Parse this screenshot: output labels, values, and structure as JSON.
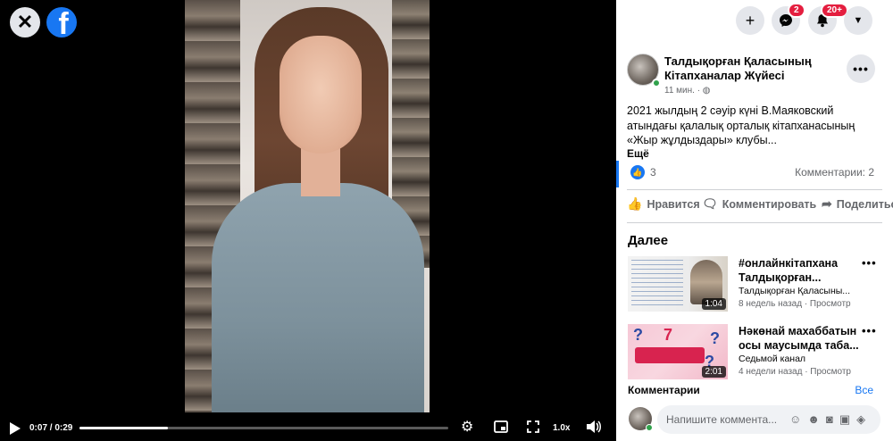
{
  "player": {
    "time_label": "0:07 / 0:29",
    "progress": 0.24,
    "speed_label": "1.0x"
  },
  "topbar": {
    "messenger_badge": "2",
    "notifications_badge": "20+"
  },
  "post": {
    "author": "Талдықорған Қаласының Кітапханалар Жүйесі",
    "time": "11 мин. · ◍",
    "text": "2021 жылдың 2 сәуір күні В.Маяковский атындағы қалалық орталық кітапханасының «Жыр жұлдыздары» клубы...",
    "see_more": "Ещё",
    "likes": "3",
    "comments_count": "Комментарии: 2",
    "actions": {
      "like": "Нравится",
      "comment": "Комментировать",
      "share": "Поделиться"
    }
  },
  "next": {
    "title": "Далее",
    "items": [
      {
        "title": "#онлайнкітапхана Талдықорған...",
        "channel": "Талдықорған Қаласыны...",
        "meta": "8 недель назад · Просмотр",
        "duration": "1:04"
      },
      {
        "title": "Нәкөнай махаббатын осы маусымда таба...",
        "channel": "Седьмой канал",
        "meta": "4 недели назад · Просмотр",
        "duration": "2:01"
      }
    ]
  },
  "comments": {
    "title": "Комментарии",
    "see_all": "Все",
    "placeholder": "Напишите коммента..."
  },
  "icons": {
    "close": "close-icon",
    "facebook": "facebook-icon",
    "play": "play-icon",
    "settings": "gear-icon",
    "pip": "picture-in-picture-icon",
    "fullscreen": "fullscreen-icon",
    "volume": "volume-icon"
  },
  "colors": {
    "brand": "#1877f2",
    "badge": "#e41e3f",
    "online": "#31a24c"
  }
}
